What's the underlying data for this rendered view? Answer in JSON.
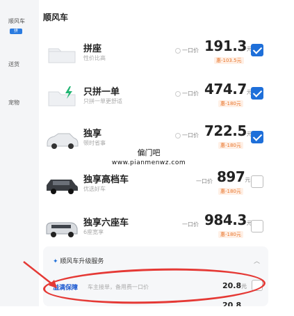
{
  "sidebar": {
    "items": [
      {
        "label": "顺风车"
      },
      {
        "label": "送货"
      },
      {
        "label": "宠物"
      }
    ],
    "badge": "拼"
  },
  "section": {
    "title": "顺风车"
  },
  "options": [
    {
      "name": "拼座",
      "sub": "性价比高",
      "one_price_label": "一口价",
      "price": "191.3",
      "unit": "元",
      "discount": "惠-103.5元",
      "checked": true,
      "icon": "folder-icon"
    },
    {
      "name": "只拼一单",
      "sub": "只拼一单更舒适",
      "one_price_label": "一口价",
      "price": "474.7",
      "unit": "元",
      "discount": "惠-180元",
      "checked": true,
      "icon": "lightning-folder-icon"
    },
    {
      "name": "独享",
      "sub": "顿时省事",
      "one_price_label": "一口价",
      "price": "722.5",
      "unit": "元",
      "discount": "惠-180元",
      "checked": true,
      "icon": "car-icon"
    },
    {
      "name": "独享高档车",
      "sub": "优选好车",
      "one_price_label": "一口价",
      "price": "897",
      "unit": "元",
      "discount": "惠-180元",
      "checked": false,
      "icon": "suv-icon"
    },
    {
      "name": "独享六座车",
      "sub": "6座宽享",
      "one_price_label": "一口价",
      "price": "984.3",
      "unit": "元",
      "discount": "惠-180元",
      "checked": false,
      "icon": "van-icon"
    }
  ],
  "upgrade": {
    "title": "顺风车升级服务",
    "service_name": "溢满保障",
    "service_desc": "车主接单，备用费一口价",
    "service_price": "20.8",
    "service_unit": "元",
    "second_price": "20.8"
  },
  "watermark": {
    "line1": "偏门吧",
    "line2": "www.pianmenwz.com"
  },
  "colors": {
    "accent": "#1e6fd9",
    "discount": "#e8742a",
    "annotation": "#e53935"
  }
}
